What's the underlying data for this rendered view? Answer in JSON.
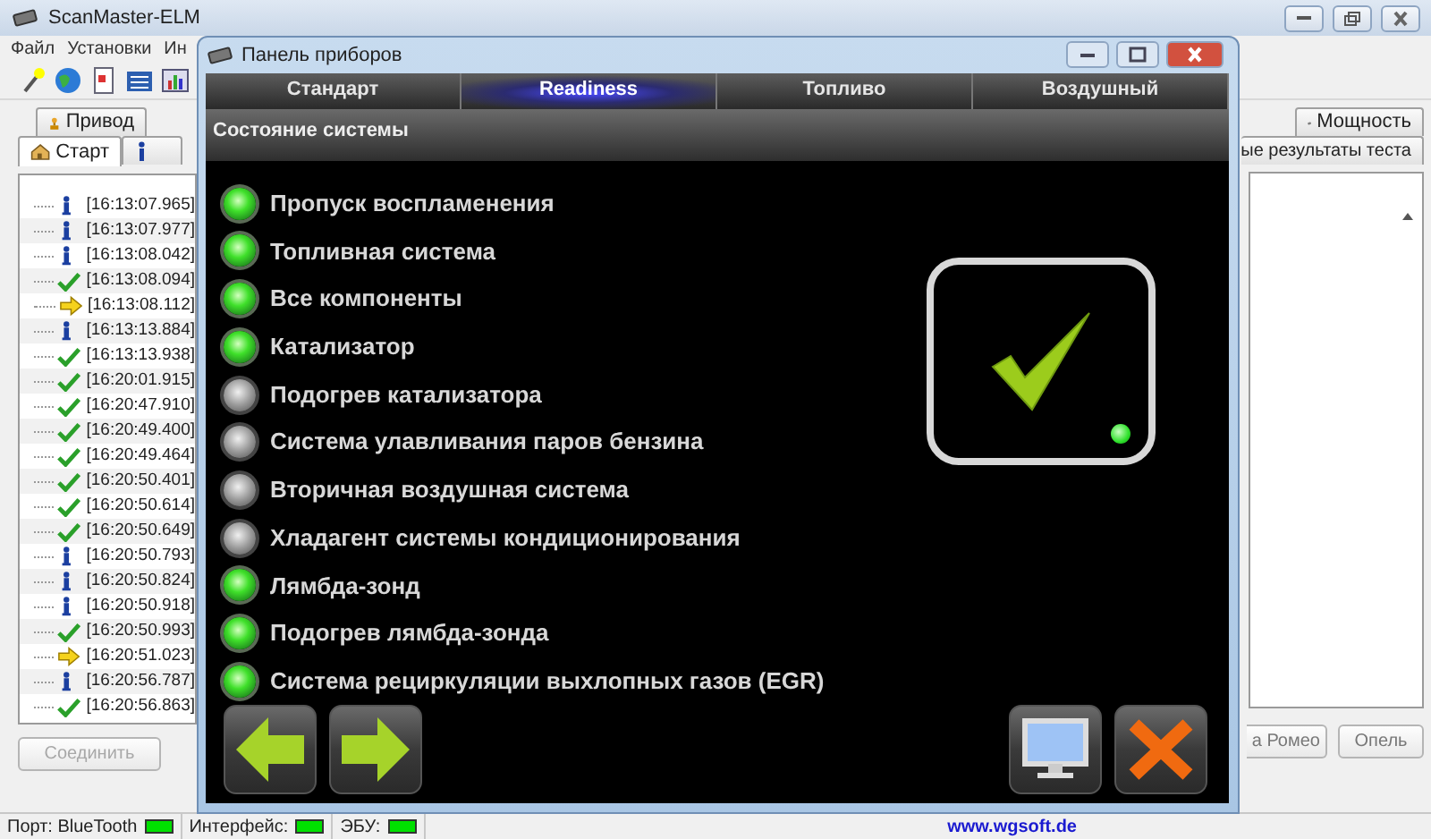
{
  "main_window": {
    "title": "ScanMaster-ELM",
    "menu": [
      "Файл",
      "Установки",
      "Ин"
    ],
    "top_tabs": [
      {
        "label": "Привод",
        "kind": "drive"
      },
      {
        "label": "Мощность",
        "kind": "power"
      }
    ],
    "start_tab": {
      "label": "Старт",
      "selected": true
    },
    "cut_tab_label": "ые результаты теста",
    "log": [
      {
        "kind": "info",
        "time": "[16:13:07.965]"
      },
      {
        "kind": "info",
        "time": "[16:13:07.977]"
      },
      {
        "kind": "info",
        "time": "[16:13:08.042]"
      },
      {
        "kind": "ok",
        "time": "[16:13:08.094]"
      },
      {
        "kind": "arrow",
        "time": "[16:13:08.112]"
      },
      {
        "kind": "info",
        "time": "[16:13:13.884]"
      },
      {
        "kind": "ok",
        "time": "[16:13:13.938]"
      },
      {
        "kind": "ok",
        "time": "[16:20:01.915]"
      },
      {
        "kind": "ok",
        "time": "[16:20:47.910]"
      },
      {
        "kind": "ok",
        "time": "[16:20:49.400]"
      },
      {
        "kind": "ok",
        "time": "[16:20:49.464]"
      },
      {
        "kind": "ok",
        "time": "[16:20:50.401]"
      },
      {
        "kind": "ok",
        "time": "[16:20:50.614]"
      },
      {
        "kind": "ok",
        "time": "[16:20:50.649]"
      },
      {
        "kind": "info",
        "time": "[16:20:50.793]"
      },
      {
        "kind": "info",
        "time": "[16:20:50.824]"
      },
      {
        "kind": "info",
        "time": "[16:20:50.918]"
      },
      {
        "kind": "ok",
        "time": "[16:20:50.993]"
      },
      {
        "kind": "arrow",
        "time": "[16:20:51.023]"
      },
      {
        "kind": "info",
        "time": "[16:20:56.787]"
      },
      {
        "kind": "ok",
        "time": "[16:20:56.863]"
      }
    ],
    "left_button": {
      "label": "Соединить",
      "disabled": true
    },
    "right_buttons": [
      {
        "label": "а Ромео",
        "disabled": false
      },
      {
        "label": "Опель",
        "disabled": false
      }
    ]
  },
  "status_bar": {
    "items": [
      {
        "label": "Порт: BlueTooth",
        "on": true
      },
      {
        "label": "Интерфейс:",
        "on": true
      },
      {
        "label": "ЭБУ:",
        "on": true
      }
    ],
    "website": "www.wgsoft.de"
  },
  "dialog": {
    "title": "Панель приборов",
    "tabs": [
      {
        "label": "Стандарт",
        "selected": false
      },
      {
        "label": "Readiness",
        "selected": true
      },
      {
        "label": "Топливо",
        "selected": false
      },
      {
        "label": "Воздушный",
        "selected": false
      }
    ],
    "section": "Состояние системы",
    "monitors": [
      {
        "label": "Пропуск воспламенения",
        "on": true
      },
      {
        "label": "Топливная система",
        "on": true
      },
      {
        "label": "Все компоненты",
        "on": true
      },
      {
        "label": "Катализатор",
        "on": true
      },
      {
        "label": "Подогрев катализатора",
        "on": false
      },
      {
        "label": "Система улавливания паров бензина",
        "on": false
      },
      {
        "label": "Вторичная воздушная система",
        "on": false
      },
      {
        "label": "Хладагент системы кондиционирования",
        "on": false
      },
      {
        "label": "Лямбда-зонд",
        "on": true
      },
      {
        "label": "Подогрев лямбда-зонда",
        "on": true
      },
      {
        "label": "Система рециркуляции выхлопных газов (EGR)",
        "on": true
      }
    ],
    "status": {
      "kind": "check",
      "led_on": true
    },
    "nav_buttons": [
      {
        "kind": "back"
      },
      {
        "kind": "forward"
      }
    ],
    "action_buttons": [
      {
        "kind": "monitor"
      },
      {
        "kind": "close"
      }
    ]
  }
}
